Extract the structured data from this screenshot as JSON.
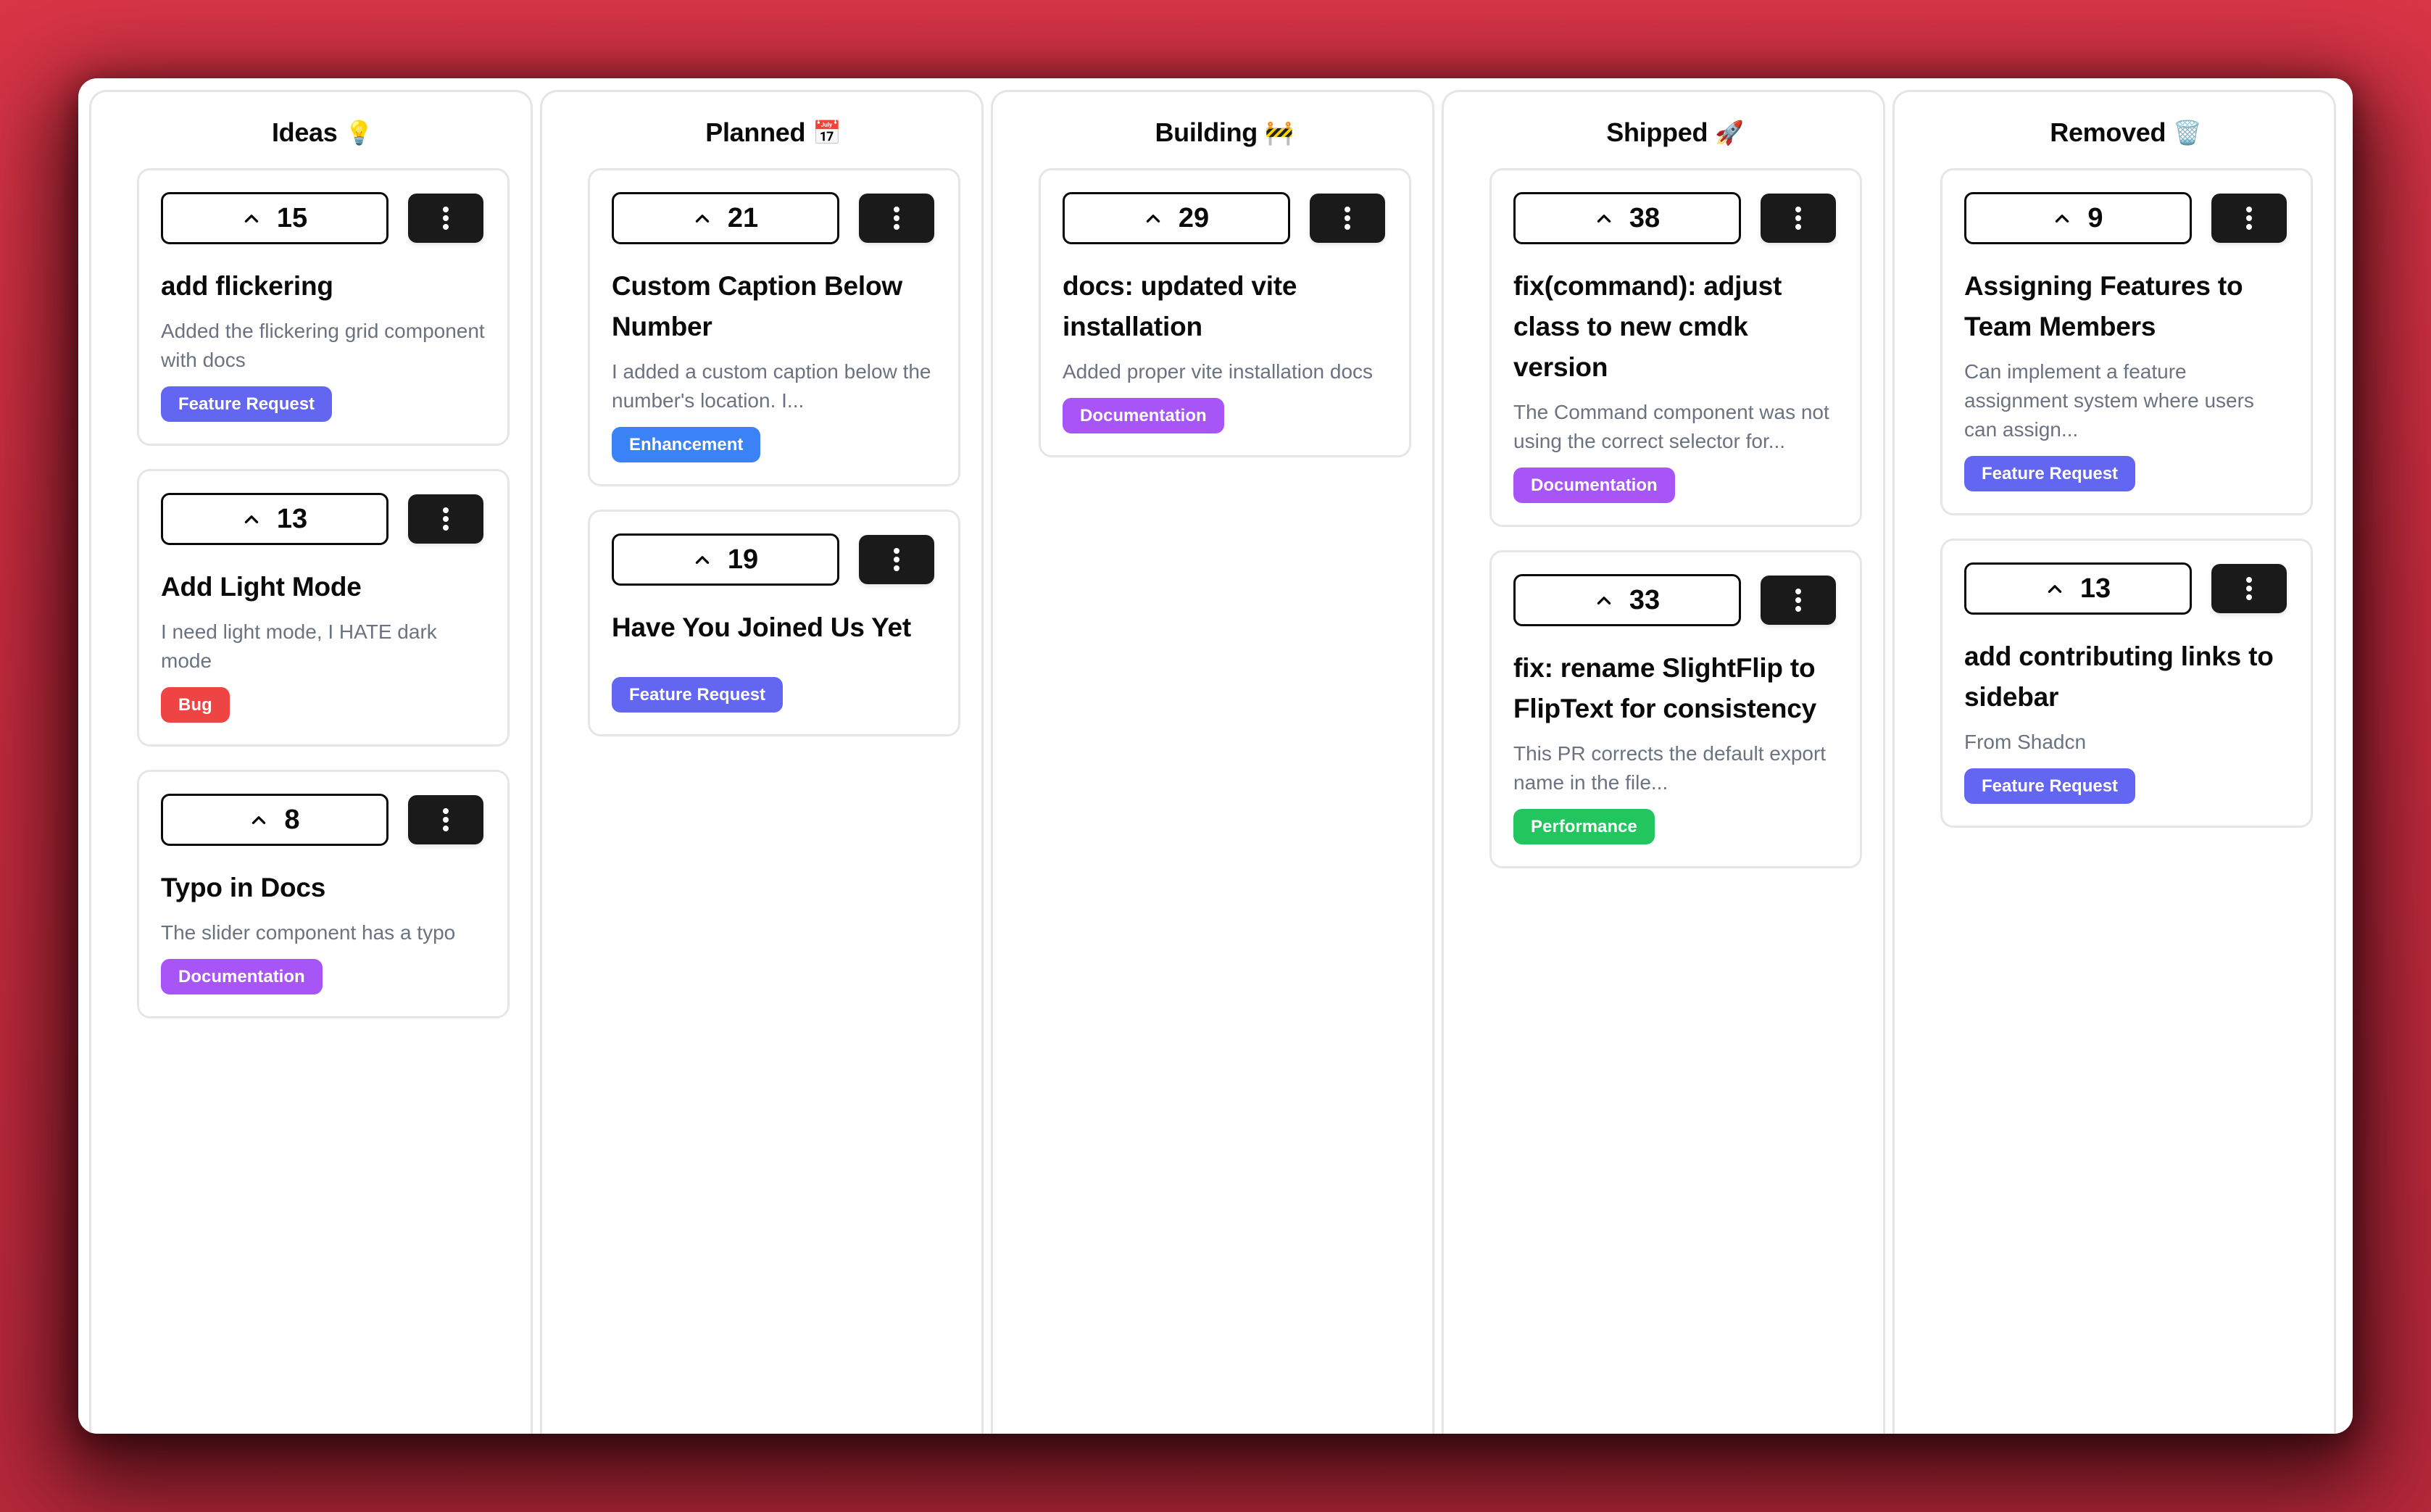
{
  "colors": {
    "background": "#d42f42",
    "tag_feature_request": "#6366f1",
    "tag_enhancement": "#3b82f6",
    "tag_documentation": "#a855f7",
    "tag_bug": "#ef4444",
    "tag_performance": "#22c55e",
    "menu_button": "#1a1a1a",
    "description_text": "#6b7280"
  },
  "columns": [
    {
      "title": "Ideas",
      "emoji": "💡",
      "icon": "lightbulb-icon",
      "cards": [
        {
          "votes": "15",
          "title": "add flickering",
          "description": "Added the flickering grid component with docs",
          "tag": "Feature Request",
          "tag_color": "#6366f1"
        },
        {
          "votes": "13",
          "title": "Add Light Mode",
          "description": "I need light mode, I HATE dark mode",
          "tag": "Bug",
          "tag_color": "#ef4444"
        },
        {
          "votes": "8",
          "title": "Typo in Docs",
          "description": "The slider component has a typo",
          "tag": "Documentation",
          "tag_color": "#a855f7"
        }
      ]
    },
    {
      "title": "Planned",
      "emoji": "📅",
      "icon": "calendar-icon",
      "cards": [
        {
          "votes": "21",
          "title": "Custom Caption Below Number",
          "description": "I added a custom caption below the number's location. I...",
          "tag": "Enhancement",
          "tag_color": "#3b82f6"
        },
        {
          "votes": "19",
          "title": "Have You Joined Us Yet",
          "description": "",
          "tag": "Feature Request",
          "tag_color": "#6366f1"
        }
      ]
    },
    {
      "title": "Building",
      "emoji": "🚧",
      "icon": "construction-icon",
      "cards": [
        {
          "votes": "29",
          "title": "docs: updated vite installation",
          "description": "Added proper vite installation docs",
          "tag": "Documentation",
          "tag_color": "#a855f7"
        }
      ]
    },
    {
      "title": "Shipped",
      "emoji": "🚀",
      "icon": "rocket-icon",
      "cards": [
        {
          "votes": "38",
          "title": "fix(command): adjust class to new cmdk version",
          "description": "The Command component was not using the correct selector for...",
          "tag": "Documentation",
          "tag_color": "#a855f7"
        },
        {
          "votes": "33",
          "title": "fix: rename SlightFlip to FlipText for consistency",
          "description": "This PR corrects the default export name in the file...",
          "tag": "Performance",
          "tag_color": "#22c55e"
        }
      ]
    },
    {
      "title": "Removed",
      "emoji": "🗑️",
      "icon": "wastebasket-icon",
      "cards": [
        {
          "votes": "9",
          "title": "Assigning Features to Team Members",
          "description": "Can implement a feature assignment system where users can assign...",
          "tag": "Feature Request",
          "tag_color": "#6366f1"
        },
        {
          "votes": "13",
          "title": "add contributing links to sidebar",
          "description": "From Shadcn",
          "tag": "Feature Request",
          "tag_color": "#6366f1"
        }
      ]
    }
  ]
}
